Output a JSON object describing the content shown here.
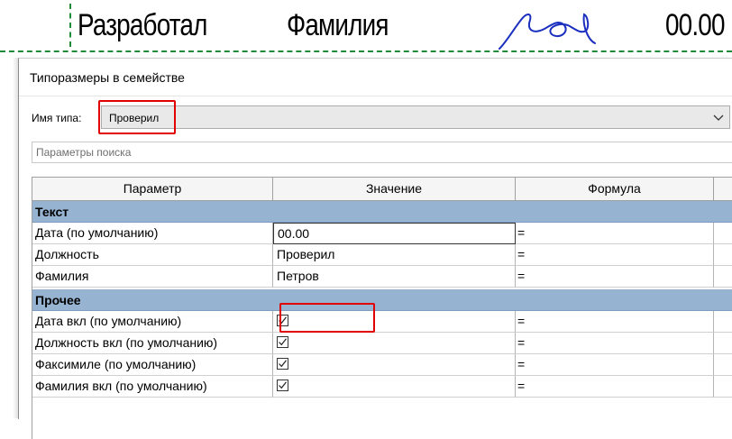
{
  "drawing": {
    "role_text": "Разработал",
    "surname_text": "Фамилия",
    "date_text": "00.00",
    "signature_color": "#1a2fbf",
    "guide_color": "#1f8a3a"
  },
  "dialog": {
    "title": "Типоразмеры в семействе",
    "type_name_label": "Имя типа:",
    "type_name_value": "Проверил",
    "search_placeholder": "Параметры поиска"
  },
  "grid": {
    "columns": [
      "Параметр",
      "Значение",
      "Формула"
    ],
    "groups": [
      {
        "name": "Текст",
        "rows": [
          {
            "parameter": "Дата (по умолчанию)",
            "value": "00.00",
            "formula": "="
          },
          {
            "parameter": "Должность",
            "value": "Проверил",
            "formula": "="
          },
          {
            "parameter": "Фамилия",
            "value": "Петров",
            "formula": "="
          }
        ]
      },
      {
        "name": "Прочее",
        "rows": [
          {
            "parameter": "Дата вкл (по умолчанию)",
            "checked": true,
            "formula": "="
          },
          {
            "parameter": "Должность вкл (по умолчанию)",
            "checked": true,
            "formula": "="
          },
          {
            "parameter": "Факсимиле (по умолчанию)",
            "checked": true,
            "formula": "="
          },
          {
            "parameter": "Фамилия вкл (по умолчанию)",
            "checked": true,
            "formula": "="
          }
        ]
      }
    ]
  },
  "colors": {
    "group_header_bg": "#96b3d1",
    "highlight": "#e00000"
  }
}
